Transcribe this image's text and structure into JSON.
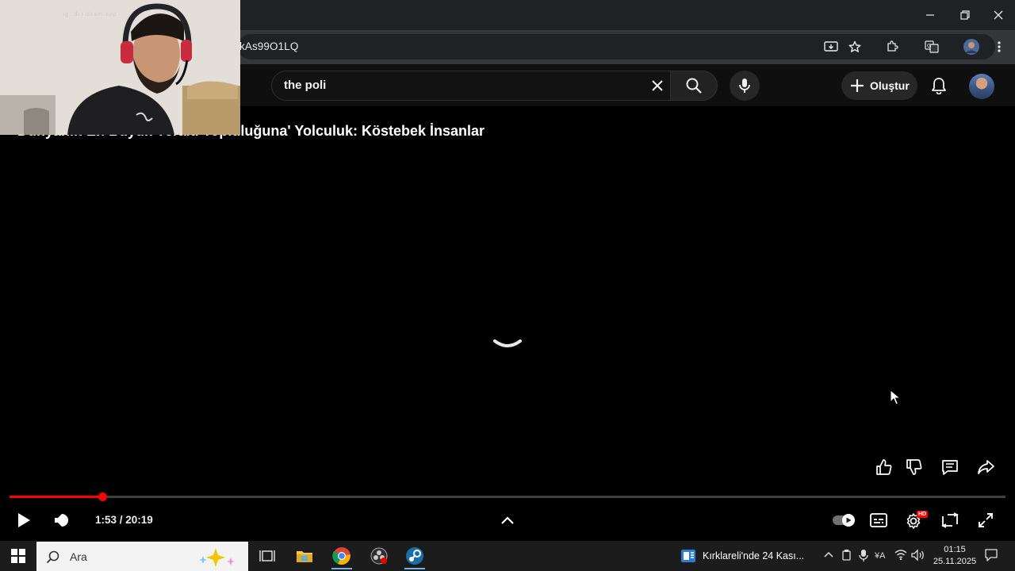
{
  "browser": {
    "url_partial": "kAs99O1LQ",
    "window_controls": [
      "minimize",
      "restore",
      "close"
    ]
  },
  "youtube": {
    "search_query": "the poli",
    "create_label": "Oluştur"
  },
  "video": {
    "title_visible": "Dünyanın En Büyük Yeraltı Topluluğuna' Yolculuk: Köstebek İnsanlar",
    "current_time": "1:53",
    "duration": "20:19",
    "time_display": "1:53 / 20:19",
    "progress_fraction": 0.093,
    "quality_badge": "HD"
  },
  "webcam": {
    "label": "ig: droidcam.app"
  },
  "taskbar": {
    "search_placeholder": "Ara",
    "news_text": "Kırklareli'nde 24 Kası...",
    "time": "01:15",
    "date": "25.11.2025"
  },
  "colors": {
    "accent": "#ff0000",
    "chrome_dark": "#202124",
    "yt_bg": "#0f0f0f"
  }
}
